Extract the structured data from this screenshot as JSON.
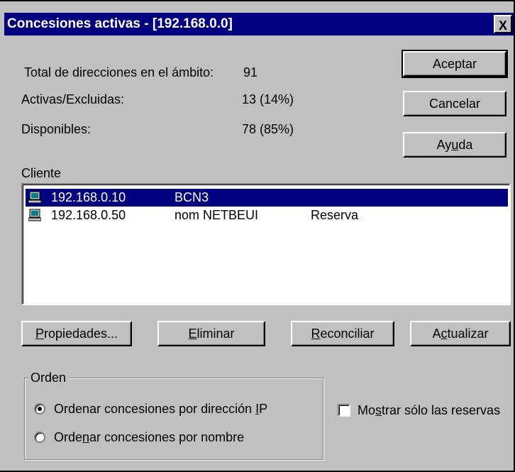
{
  "window": {
    "title": "Concesiones activas - [192.168.0.0]",
    "close_glyph": "X"
  },
  "stats": {
    "total_label": "Total de direcciones en el ámbito:",
    "total_value": "91",
    "active_label": "Activas/Excluidas:",
    "active_value": "13 (14%)",
    "available_label": "Disponibles:",
    "available_value": "78 (85%)"
  },
  "buttons": {
    "ok": "Aceptar",
    "cancel": "Cancelar",
    "help_pre": "Ay",
    "help_u": "u",
    "help_post": "da",
    "properties_u": "P",
    "properties_post": "ropiedades...",
    "delete_u": "E",
    "delete_post": "liminar",
    "reconcile_u": "R",
    "reconcile_post": "econciliar",
    "refresh_pre": "A",
    "refresh_u": "c",
    "refresh_post": "tualizar"
  },
  "list": {
    "header": "Cliente",
    "rows": [
      {
        "ip": "192.168.0.10",
        "name": "BCN3",
        "note": "",
        "selected": true,
        "icon": "computer-icon"
      },
      {
        "ip": "192.168.0.50",
        "name": "nom NETBEUI",
        "note": "Reserva",
        "selected": false,
        "icon": "computer-icon"
      }
    ]
  },
  "order": {
    "legend": "Orden",
    "by_ip_pre": "Ordenar concesiones por dirección ",
    "by_ip_u": "I",
    "by_ip_post": "P",
    "by_name_pre": "Orde",
    "by_name_u": "n",
    "by_name_post": "ar concesiones por nombre",
    "selected": "by_ip"
  },
  "reservations_only": {
    "pre": "Mo",
    "u": "s",
    "post": "trar sólo las reservas",
    "checked": false
  },
  "colors": {
    "face": "#c0c0c0",
    "title": "#000080",
    "selection": "#000080"
  }
}
